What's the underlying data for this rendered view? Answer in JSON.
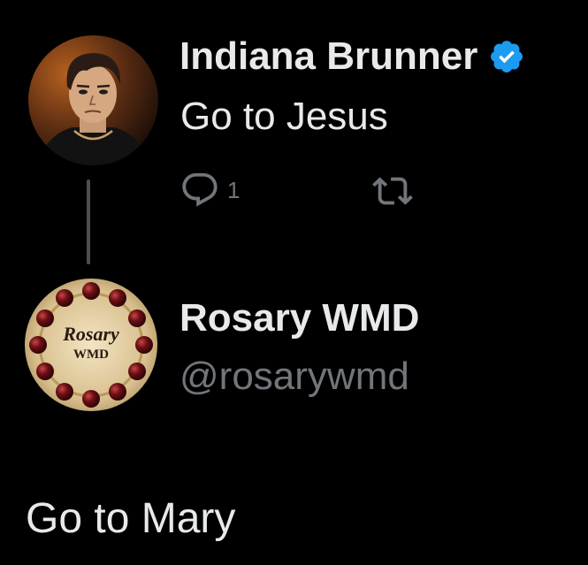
{
  "tweet": {
    "author": {
      "display_name": "Indiana Brunner",
      "verified": true,
      "avatar_icon": "cartoon-man-avatar"
    },
    "text": "Go to Jesus",
    "actions": {
      "reply_count": "1",
      "reply_icon": "reply-bubble-icon",
      "retweet_icon": "retweet-icon"
    }
  },
  "reply": {
    "author": {
      "display_name": "Rosary WMD",
      "handle": "@rosarywmd",
      "avatar_text_line1": "Rosary",
      "avatar_text_line2": "WMD"
    },
    "text": "Go to Mary"
  },
  "colors": {
    "background": "#000000",
    "primary_text": "#e7e9ea",
    "secondary_text": "#71767b",
    "verified_badge": "#1d9bf0",
    "thread_line": "#4b4f54"
  }
}
